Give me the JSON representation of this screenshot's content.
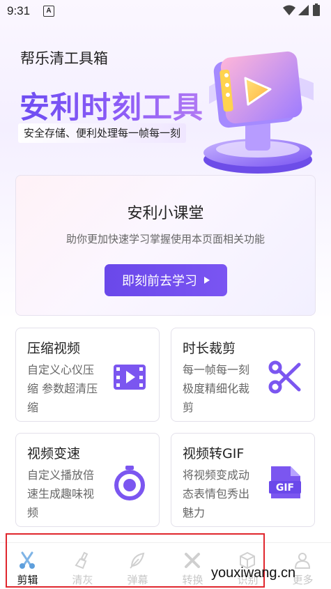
{
  "status_bar": {
    "time": "9:31",
    "notification_badge": "A"
  },
  "header": {
    "app_title": "帮乐清工具箱",
    "hero_title": "安利时刻工具",
    "hero_subtitle": "安全存储、便利处理每一帧每一刻"
  },
  "course": {
    "title": "安利小课堂",
    "description": "助你更加快速学习掌握使用本页面相关功能",
    "button_label": "即刻前去学习"
  },
  "features": [
    {
      "title": "压缩视频",
      "description": "自定义心仪压缩 参数超清压缩",
      "icon": "film-play-icon"
    },
    {
      "title": "时长裁剪",
      "description": "每一帧每一刻极度精细化裁剪",
      "icon": "scissors-icon"
    },
    {
      "title": "视频变速",
      "description": "自定义播放倍速生成趣味视频",
      "icon": "stopwatch-icon"
    },
    {
      "title": "视频转GIF",
      "description": "将视频变成动态表情包秀出魅力",
      "icon": "gif-file-icon"
    }
  ],
  "gif_icon_text": "GIF",
  "bottom_nav": [
    {
      "label": "剪辑",
      "icon": "scissors-icon",
      "active": true
    },
    {
      "label": "清灰",
      "icon": "brush-icon",
      "active": false
    },
    {
      "label": "弹幕",
      "icon": "feather-icon",
      "active": false
    },
    {
      "label": "转换",
      "icon": "tools-icon",
      "active": false
    },
    {
      "label": "识别",
      "icon": "cube-icon",
      "active": false
    },
    {
      "label": "更多",
      "icon": "user-icon",
      "active": false
    }
  ],
  "watermark": "youxiwang.cn",
  "colors": {
    "accent": "#6a48ea",
    "icon_purple": "#7b56f0",
    "highlight_box": "#e0262d"
  }
}
